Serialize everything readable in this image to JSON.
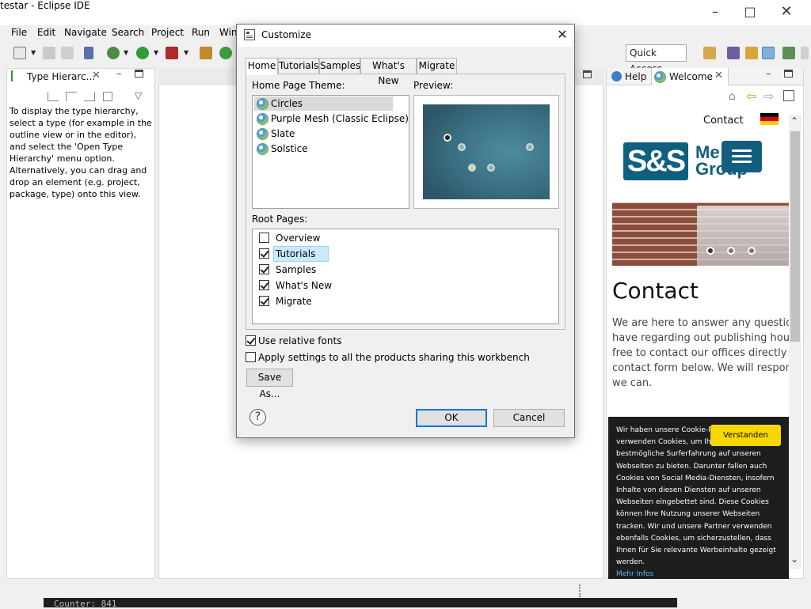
{
  "window": {
    "title": "testar - Eclipse IDE"
  },
  "menu": [
    "File",
    "Edit",
    "Navigate",
    "Search",
    "Project",
    "Run",
    "Win"
  ],
  "toolbar": {
    "quick_access": "Quick Access"
  },
  "type_hierarchy": {
    "tab_label": "Type Hierarc...",
    "message": "To display the type hierarchy, select a type (for example in the outline view or in the editor), and select the 'Open Type Hierarchy' menu option. Alternatively, you can drag and drop an element (e.g. project, package, type) onto this view."
  },
  "right_view": {
    "help_tab": "Help",
    "welcome_tab": "Welcome",
    "contact_link": "Contact",
    "logo_left": "S&S",
    "logo_right_1": "Me",
    "logo_right_2": "Group",
    "heading": "Contact",
    "body_lines": [
      "We are here to answer any questions",
      "have regarding out publishing house.",
      "free to contact our offices directly or u",
      "contact form below. We will respond a",
      "we can."
    ],
    "cookie": {
      "text": "Wir haben unsere Cookie-Policy geändert. Wir verwenden Cookies, um Ihnen die bestmögliche Surferfahrung auf unseren Webseiten zu bieten. Darunter fallen auch Cookies von Social Media-Diensten, insofern Inhalte von diesen Diensten auf unseren Webseiten eingebettet sind. Diese Cookies können Ihre Nutzung unserer Webseiten tracken. Wir und unsere Partner verwenden ebenfalls Cookies, um sicherzustellen, dass Ihnen für Sie relevante Werbeinhalte gezeigt werden.",
      "more": "Mehr Infos",
      "button": "Verstanden"
    }
  },
  "console": {
    "text": "Counter: 841"
  },
  "dialog": {
    "title": "Customize",
    "tabs": [
      "Home",
      "Tutorials",
      "Samples",
      "What's New",
      "Migrate"
    ],
    "active_tab": "Home",
    "theme_label": "Home Page Theme:",
    "preview_label": "Preview:",
    "themes": [
      "Circles",
      "Purple Mesh (Classic Eclipse)",
      "Slate",
      "Solstice"
    ],
    "selected_theme": "Circles",
    "root_pages_label": "Root Pages:",
    "root_pages": [
      {
        "label": "Overview",
        "checked": false
      },
      {
        "label": "Tutorials",
        "checked": true
      },
      {
        "label": "Samples",
        "checked": true
      },
      {
        "label": "What's New",
        "checked": true
      },
      {
        "label": "Migrate",
        "checked": true
      }
    ],
    "use_relative_fonts": {
      "label": "Use relative fonts",
      "checked": true
    },
    "apply_all": {
      "label": "Apply settings to all the products sharing this workbench",
      "checked": false
    },
    "save_as": "Save As...",
    "ok": "OK",
    "cancel": "Cancel",
    "help": "?"
  },
  "colors": {
    "accent": "#0078d7",
    "cookie_button": "#f7d700",
    "brand": "#135d7e"
  }
}
